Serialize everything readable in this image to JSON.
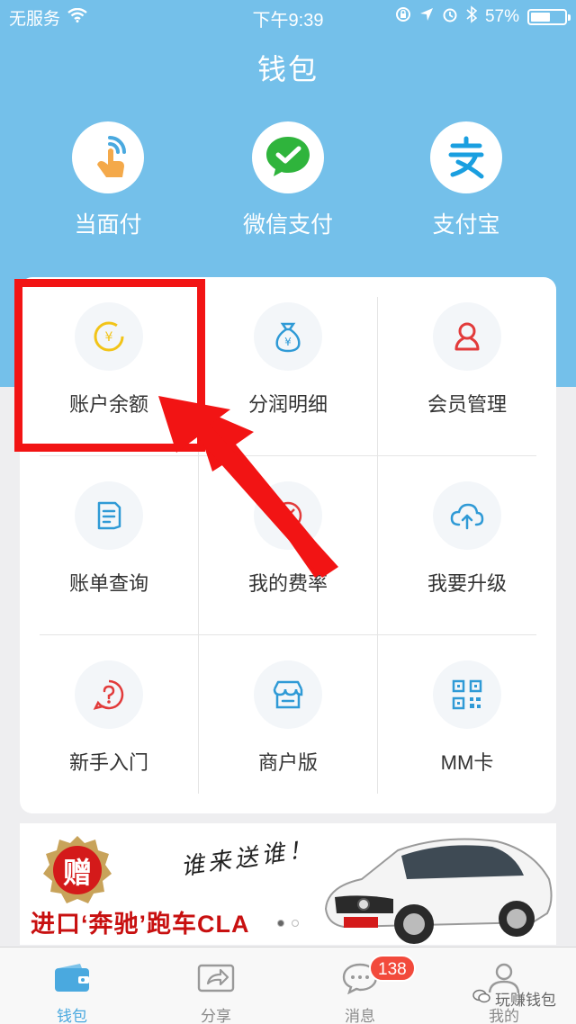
{
  "status_bar": {
    "carrier": "无服务",
    "time": "下午9:39",
    "battery_percent": "57%",
    "battery_level": 0.57
  },
  "header": {
    "title": "钱包"
  },
  "pay_methods": [
    {
      "label": "当面付",
      "icon": "hand-tap-icon"
    },
    {
      "label": "微信支付",
      "icon": "wechat-pay-icon"
    },
    {
      "label": "支付宝",
      "icon": "alipay-icon"
    }
  ],
  "grid": [
    {
      "label": "账户余额",
      "icon": "balance-icon"
    },
    {
      "label": "分润明细",
      "icon": "moneybag-icon"
    },
    {
      "label": "会员管理",
      "icon": "member-icon"
    },
    {
      "label": "账单查询",
      "icon": "bill-icon"
    },
    {
      "label": "我的费率",
      "icon": "rate-icon"
    },
    {
      "label": "我要升级",
      "icon": "cloud-upload-icon"
    },
    {
      "label": "新手入门",
      "icon": "help-icon"
    },
    {
      "label": "商户版",
      "icon": "store-icon"
    },
    {
      "label": "MM卡",
      "icon": "qrcode-icon"
    }
  ],
  "banner": {
    "badge": "赠",
    "slogan": "谁来送谁！",
    "text": "进口‘奔驰’跑车CLA"
  },
  "tabs": [
    {
      "label": "钱包",
      "icon": "wallet-icon",
      "active": true
    },
    {
      "label": "分享",
      "icon": "share-icon",
      "active": false
    },
    {
      "label": "消息",
      "icon": "message-icon",
      "active": false,
      "badge": "138"
    },
    {
      "label": "我的",
      "icon": "profile-icon",
      "active": false
    }
  ],
  "watermark": "玩赚钱包",
  "colors": {
    "header_bg": "#74c0ea",
    "accent": "#4aa9df",
    "highlight": "#f21414",
    "badge_red": "#f24a3c"
  }
}
